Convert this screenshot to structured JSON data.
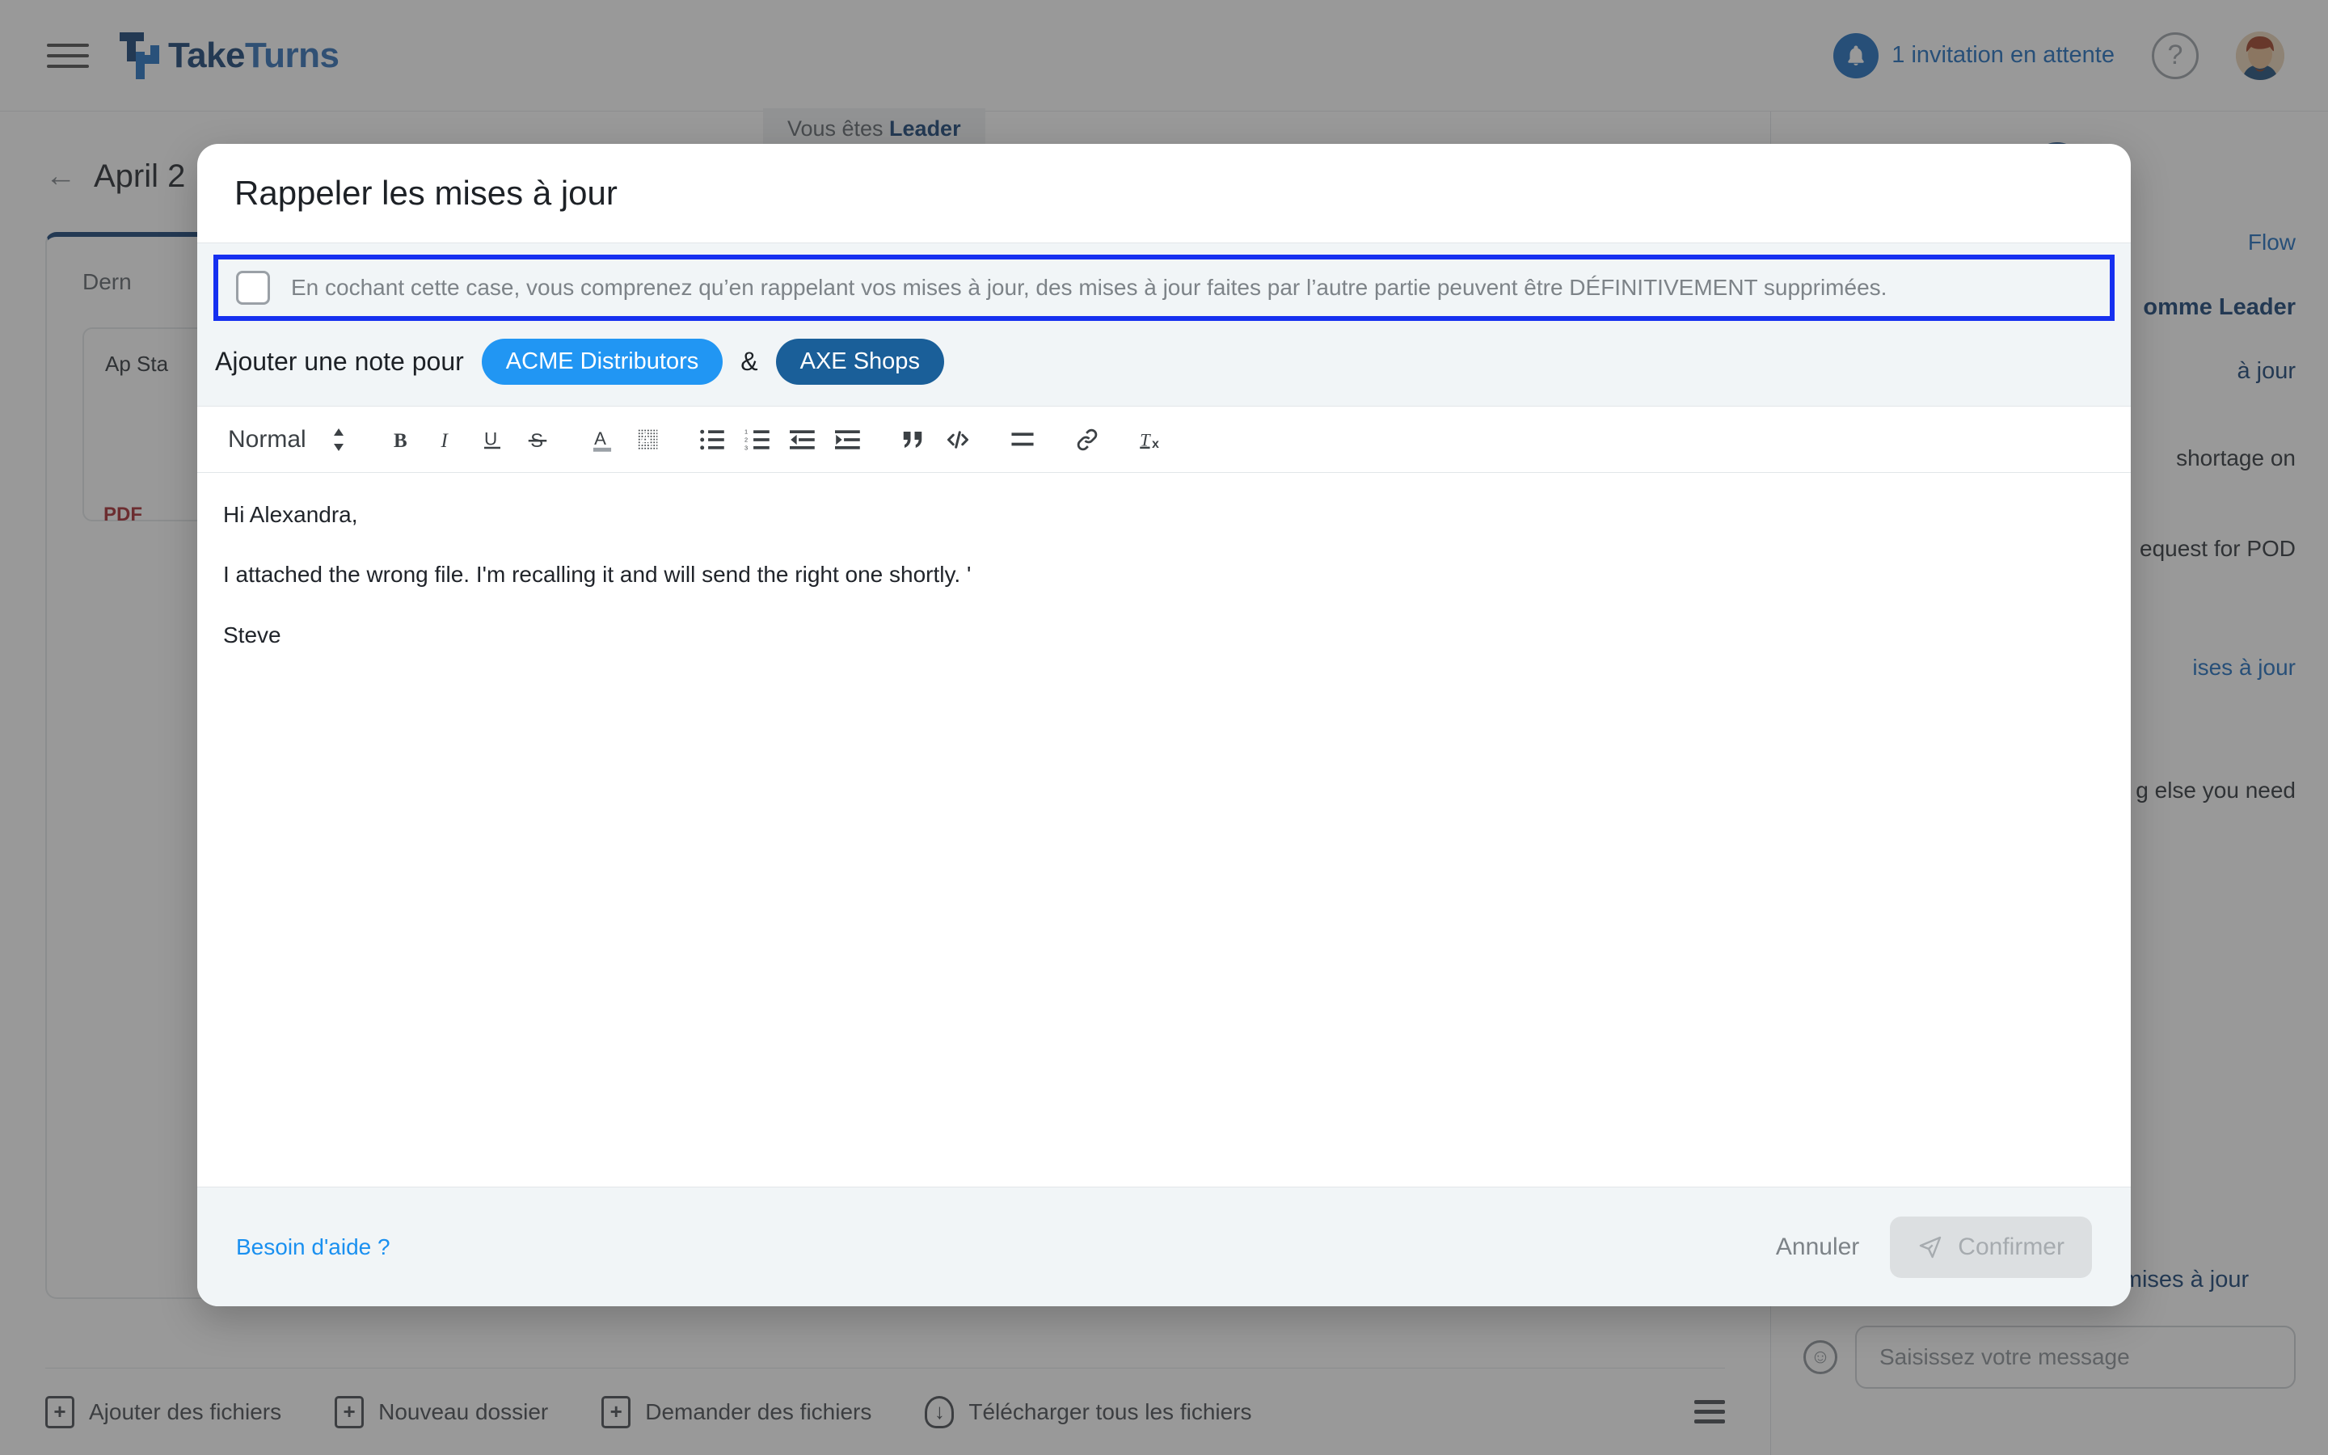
{
  "topbar": {
    "menu_icon": "hamburger-icon",
    "brand_part1": "Take",
    "brand_part2": "Turns",
    "notification_icon": "bell-icon",
    "notification_text": "1 invitation en attente",
    "help_icon": "question-mark-icon",
    "avatar_icon": "user-avatar",
    "accent_blue": "#1a6bbd",
    "brand_dark": "#123f73"
  },
  "background": {
    "leader_badge_prefix": "Vous êtes ",
    "leader_badge_strong": "Leader",
    "back_icon": "arrow-left-icon",
    "doc_title": "April 2",
    "card_subtitle": "Dern",
    "file_title": "Ap\nSta",
    "pdf_label": "PDF",
    "bottom_actions": [
      {
        "icon": "file-plus-icon",
        "label": "Ajouter des fichiers"
      },
      {
        "icon": "folder-plus-icon",
        "label": "Nouveau dossier"
      },
      {
        "icon": "square-plus-icon",
        "label": "Demander des fichiers"
      },
      {
        "icon": "cloud-download-icon",
        "label": "Télécharger tous les fichiers"
      }
    ],
    "list_view_icon": "list-view-icon",
    "side": {
      "collapse_icon": "chevron-double-right-icon",
      "avatar_icon": "contact-avatar",
      "link_flow": "Flow",
      "leader_line": "omme Leader",
      "sent_line": "à jour",
      "message_1": "shortage on",
      "message_2": "equest for POD",
      "message_3": "g else you need",
      "link_updates": "ises à jour",
      "sent_note": "AXE Shops a envoyé des mises à jour",
      "emoji_icon": "smiley-icon",
      "composer_placeholder": "Saisissez votre message"
    }
  },
  "modal": {
    "title": "Rappeler les mises à jour",
    "consent": {
      "checkbox_icon": "checkbox-unchecked",
      "checked": false,
      "text": "En cochant cette case, vous comprenez qu’en rappelant vos mises à jour, des mises à jour faites par l’autre partie peuvent être DÉFINITIVEMENT supprimées.",
      "highlight_color": "#1630f0"
    },
    "note_row": {
      "label": "Ajouter une note pour",
      "party_a": "ACME Distributors",
      "party_a_color": "#2196f3",
      "conjunction": "&",
      "party_b": "AXE Shops",
      "party_b_color": "#1a5f99"
    },
    "toolbar": {
      "format_select_value": "Normal",
      "select_icon": "updown-arrows-icon",
      "buttons": [
        {
          "icon": "bold-icon",
          "label": "B"
        },
        {
          "icon": "italic-icon",
          "label": "I"
        },
        {
          "icon": "underline-icon",
          "label": "U"
        },
        {
          "icon": "strikethrough-icon",
          "label": "S"
        },
        {
          "icon": "text-color-icon",
          "label": "A"
        },
        {
          "icon": "background-color-icon",
          "label": "A"
        },
        {
          "icon": "bullet-list-icon",
          "label": ""
        },
        {
          "icon": "numbered-list-icon",
          "label": ""
        },
        {
          "icon": "outdent-icon",
          "label": ""
        },
        {
          "icon": "indent-icon",
          "label": ""
        },
        {
          "icon": "blockquote-icon",
          "label": ""
        },
        {
          "icon": "code-block-icon",
          "label": ""
        },
        {
          "icon": "align-icon",
          "label": ""
        },
        {
          "icon": "link-icon",
          "label": ""
        },
        {
          "icon": "clear-format-icon",
          "label": ""
        }
      ]
    },
    "body": {
      "line1": "Hi Alexandra,",
      "line2": "I attached the wrong file. I'm recalling it and will send the right one shortly. '",
      "line3": "Steve"
    },
    "footer": {
      "help_link": "Besoin d'aide ?",
      "cancel_label": "Annuler",
      "confirm_icon": "send-icon",
      "confirm_label": "Confirmer"
    }
  }
}
